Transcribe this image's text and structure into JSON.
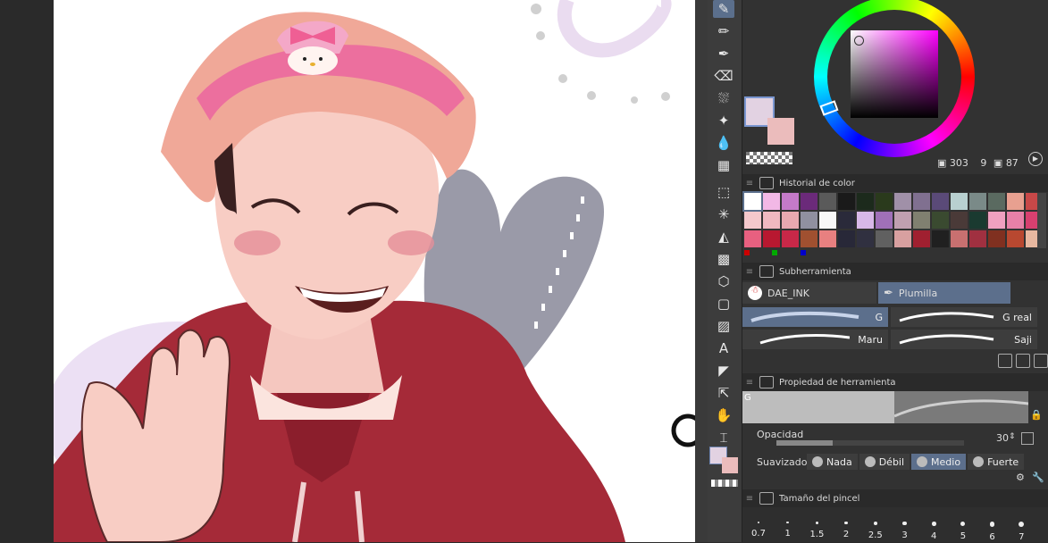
{
  "toolbar": {
    "tools": [
      {
        "name": "pen-tool-icon",
        "glyph": "✎",
        "active": true
      },
      {
        "name": "pencil-tool-icon",
        "glyph": "✏",
        "active": false
      },
      {
        "name": "ink-pen-tool-icon",
        "glyph": "✒",
        "active": false
      },
      {
        "name": "eraser-tool-icon",
        "glyph": "⌫",
        "active": false
      },
      {
        "name": "spray-tool-icon",
        "glyph": "⛆",
        "active": false
      },
      {
        "name": "sparkle-tool-icon",
        "glyph": "✦",
        "active": false
      },
      {
        "name": "blend-tool-icon",
        "glyph": "💧",
        "active": false
      },
      {
        "name": "grid-tool-icon",
        "glyph": "▦",
        "active": false
      },
      {
        "name": "selection-tool-icon",
        "glyph": "⬚",
        "active": false
      },
      {
        "name": "magic-wand-tool-icon",
        "glyph": "✳",
        "active": false
      },
      {
        "name": "fill-tool-icon",
        "glyph": "◭",
        "active": false
      },
      {
        "name": "gradient-tool-icon",
        "glyph": "▩",
        "active": false
      },
      {
        "name": "3d-object-tool-icon",
        "glyph": "⬡",
        "active": false
      },
      {
        "name": "frame-tool-icon",
        "glyph": "▢",
        "active": false
      },
      {
        "name": "pattern-tool-icon",
        "glyph": "▨",
        "active": false
      },
      {
        "name": "text-tool-icon",
        "glyph": "A",
        "active": false
      },
      {
        "name": "balloon-tool-icon",
        "glyph": "◤",
        "active": false
      },
      {
        "name": "move-tool-icon",
        "glyph": "⇱",
        "active": false
      },
      {
        "name": "hand-tool-icon",
        "glyph": "✋",
        "active": false
      },
      {
        "name": "eyedropper-tool-icon",
        "glyph": "⌶",
        "active": false
      }
    ]
  },
  "color_wheel": {
    "readout_h": "303",
    "readout_s": "9",
    "readout_v": "87",
    "main_color": "#e2d2e2",
    "sub_color": "#ebbcbc"
  },
  "color_history": {
    "title": "Historial de color",
    "swatches": [
      "#ffffff",
      "#f2b8e6",
      "#c47ac8",
      "#6b2a7a",
      "#5a5a5a",
      "#1a1a1a",
      "#1c2a1c",
      "#2a3a1c",
      "#a090a8",
      "#807090",
      "#5a4a78",
      "#b8d0d0",
      "#7a8a88",
      "#5a6a60",
      "#e8a090",
      "#c84848",
      "#f5c8cc",
      "#f0b8c0",
      "#e8a8b0",
      "#9090a0",
      "#f8f8f8",
      "#2a2a3a",
      "#d8b8e8",
      "#a070b8",
      "#c0a0b0",
      "#808070",
      "#3a4a30",
      "#4a3a38",
      "#1a3a30",
      "#f0a0c0",
      "#e880a8",
      "#d84070",
      "#e86080",
      "#b81830",
      "#c82848",
      "#a05030",
      "#e88080",
      "#282838",
      "#303040",
      "#606060",
      "#d8a0a0",
      "#a02030",
      "#202020",
      "#c87070",
      "#a03040",
      "#803020",
      "#b84830",
      "#e8b8a0"
    ]
  },
  "sub_tool": {
    "title": "Subherramienta",
    "tabs": [
      {
        "label": "DAE_INK",
        "active": false
      },
      {
        "label": "Plumilla",
        "active": true
      }
    ],
    "brushes": [
      {
        "label": "G",
        "active": true
      },
      {
        "label": "G real",
        "active": false
      },
      {
        "label": "Maru",
        "active": false
      },
      {
        "label": "Saji",
        "active": false
      }
    ]
  },
  "tool_property": {
    "title": "Propiedad de herramienta",
    "preview_label": "G",
    "opacity_label": "Opacidad",
    "opacity_value": "30",
    "opacity_fraction": 0.3,
    "stabilization_label": "Suavizado",
    "stabilization_options": [
      {
        "label": "Nada",
        "active": false
      },
      {
        "label": "Débil",
        "active": false
      },
      {
        "label": "Medio",
        "active": true
      },
      {
        "label": "Fuerte",
        "active": false
      }
    ]
  },
  "brush_size": {
    "title": "Tamaño del pincel",
    "sizes": [
      "0.7",
      "1",
      "1.5",
      "2",
      "2.5",
      "3",
      "4",
      "5",
      "6",
      "7"
    ]
  }
}
